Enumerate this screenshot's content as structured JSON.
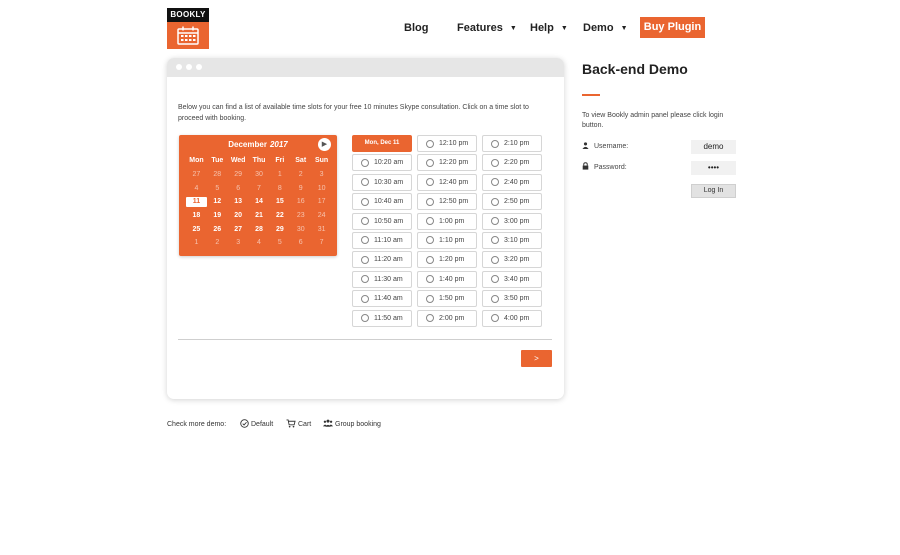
{
  "brand": {
    "logo_text": "BOOKLY",
    "accent": "#ea6530"
  },
  "nav": {
    "blog": "Blog",
    "features": "Features",
    "help": "Help",
    "demo": "Demo",
    "caret": "▼",
    "buy": "Buy Plugin"
  },
  "intro": "Below you can find a list of available time slots for your free 10 minutes Skype consultation. Click on a time slot to proceed with booking.",
  "calendar": {
    "month": "December",
    "year": "2017",
    "next_icon": "▶",
    "weekdays": [
      "Mon",
      "Tue",
      "Wed",
      "Thu",
      "Fri",
      "Sat",
      "Sun"
    ],
    "weeks": [
      [
        "27",
        "28",
        "29",
        "30",
        "1",
        "2",
        "3"
      ],
      [
        "4",
        "5",
        "6",
        "7",
        "8",
        "9",
        "10"
      ],
      [
        "11",
        "12",
        "13",
        "14",
        "15",
        "16",
        "17"
      ],
      [
        "18",
        "19",
        "20",
        "21",
        "22",
        "23",
        "24"
      ],
      [
        "25",
        "26",
        "27",
        "28",
        "29",
        "30",
        "31"
      ],
      [
        "1",
        "2",
        "3",
        "4",
        "5",
        "6",
        "7"
      ]
    ],
    "selected": "11"
  },
  "slots": {
    "day_label": "Mon, Dec 11",
    "col1": [
      "10:20 am",
      "10:30 am",
      "10:40 am",
      "10:50 am",
      "11:10 am",
      "11:20 am",
      "11:30 am",
      "11:40 am",
      "11:50 am"
    ],
    "col2": [
      "12:10 pm",
      "12:20 pm",
      "12:40 pm",
      "12:50 pm",
      "1:00 pm",
      "1:10 pm",
      "1:20 pm",
      "1:40 pm",
      "1:50 pm",
      "2:00 pm"
    ],
    "col3": [
      "2:10 pm",
      "2:20 pm",
      "2:40 pm",
      "2:50 pm",
      "3:00 pm",
      "3:10 pm",
      "3:20 pm",
      "3:40 pm",
      "3:50 pm",
      "4:00 pm"
    ]
  },
  "next_button": ">",
  "demos": {
    "label": "Check more demo:",
    "default": "Default",
    "cart": "Cart",
    "group": "Group booking"
  },
  "sidebar": {
    "title": "Back-end Demo",
    "text": "To view Bookly admin panel please click login button.",
    "username_label": "Username:",
    "username_value": "demo",
    "password_label": "Password:",
    "password_value": "••••",
    "login": "Log In"
  }
}
